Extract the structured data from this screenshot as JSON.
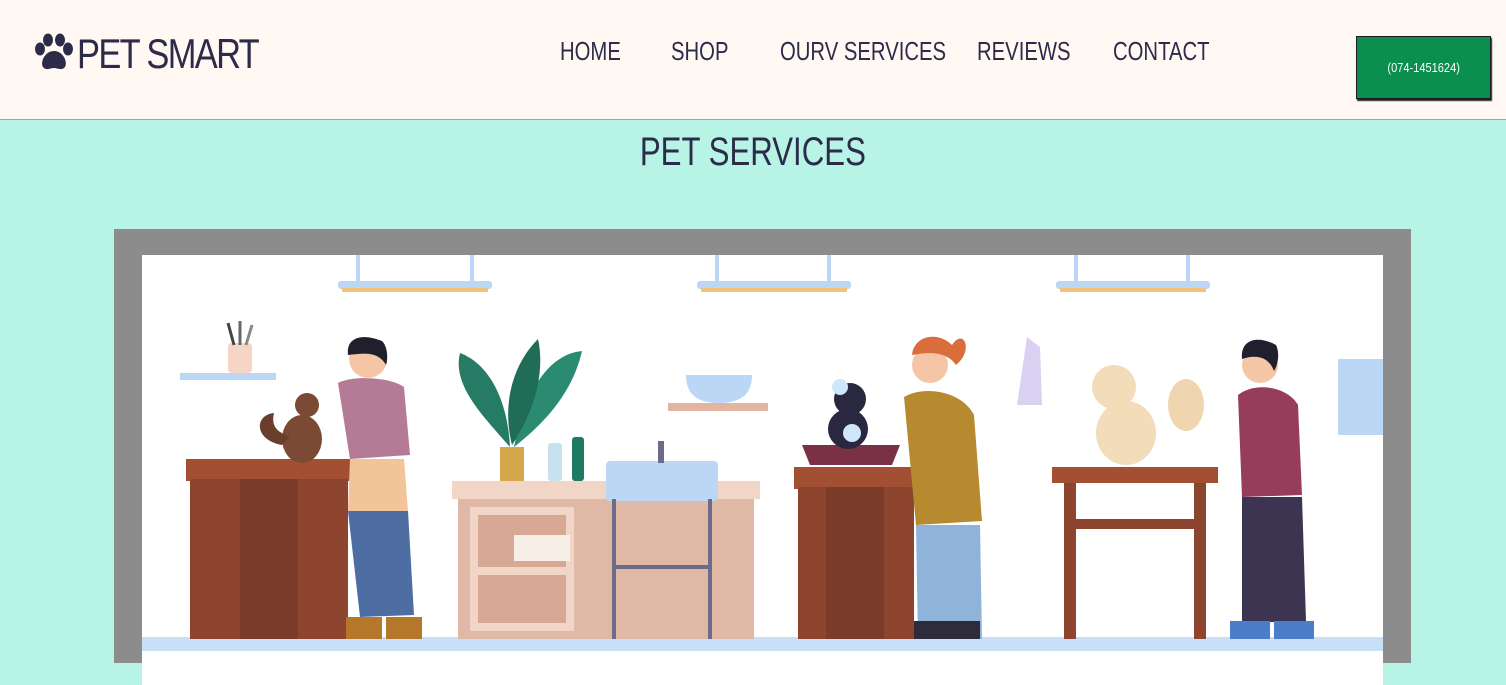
{
  "brand": {
    "name": "PET SMART",
    "icon": "paw-icon"
  },
  "nav": {
    "items": [
      {
        "label": "HOME"
      },
      {
        "label": "SHOP"
      },
      {
        "label": "OURV SERVICES"
      },
      {
        "label": "REVIEWS"
      },
      {
        "label": "CONTACT"
      }
    ]
  },
  "phone_button": {
    "label": "(074-1451624)"
  },
  "main": {
    "title": "PET SERVICES"
  },
  "colors": {
    "header_bg": "#fff8f3",
    "page_bg": "#b8f4e6",
    "text": "#2c2c4a",
    "phone_button": "#0a8f4f",
    "frame": "#8c8c8c"
  }
}
